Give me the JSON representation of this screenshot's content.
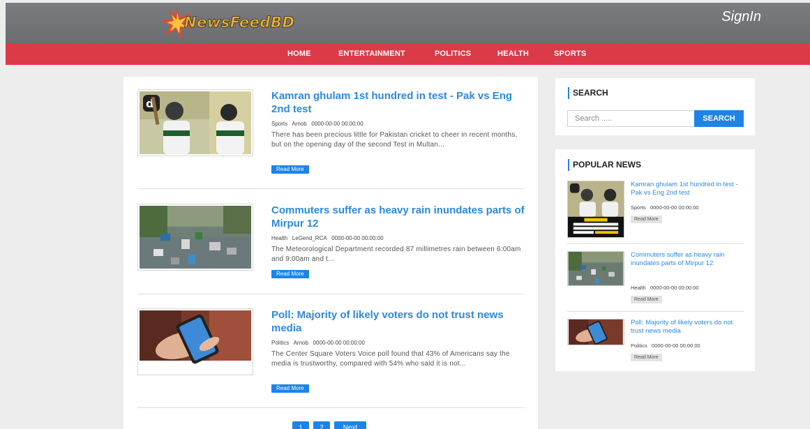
{
  "header": {
    "logo_text": "NewsFeedBD",
    "signin_label": "SignIn"
  },
  "nav": {
    "items": [
      "HOME",
      "ENTERTAINMENT",
      "POLITICS",
      "HEALTH",
      "SPORTS"
    ]
  },
  "articles": [
    {
      "title": "Kamran ghulam 1st hundred in test - Pak vs Eng 2nd test",
      "category": "Sports",
      "author": "Arnob",
      "date": "0000-00-00 00:00:00",
      "excerpt": "There has been precious little for Pakistan cricket to cheer in recent months, but on the opening day of the second Test in Multan...",
      "read_more": "Read More",
      "thumb_icon": "cricket-players-image"
    },
    {
      "title": "Commuters suffer as heavy rain inundates parts of Mirpur 12",
      "category": "Health",
      "author": "LeGend_RCA",
      "date": "0000-00-00 00:00:00",
      "excerpt": "The Meteorological Department recorded 87 millimetres rain between 6:00am and 9:00am and t...",
      "read_more": "Read More",
      "thumb_icon": "flooded-street-image"
    },
    {
      "title": "Poll: Majority of likely voters do not trust news media",
      "category": "Politics",
      "author": "Arnob",
      "date": "0000-00-00 00:00:00",
      "excerpt": "The Center Square Voters Voice poll found that 43% of Americans say the media is trustworthy, compared with 54% who said it is not...",
      "read_more": "Read More",
      "thumb_icon": "smartphone-hand-image"
    }
  ],
  "pagination": {
    "pages": [
      "1",
      "2"
    ],
    "next_label": "Next"
  },
  "search": {
    "heading": "SEARCH",
    "placeholder": "Search .....",
    "button_label": "SEARCH"
  },
  "popular": {
    "heading": "POPULAR NEWS",
    "items": [
      {
        "title": "Kamran ghulam 1st hundred in test - Pak vs Eng 2nd test",
        "category": "Sports",
        "date": "0000-00-00 00:00:00",
        "read_more": "Read More",
        "thumb_caption": "Replacement Kamran Ghulam Scores Brilliant Century Against England"
      },
      {
        "title": "Commuters suffer as heavy rain inundates parts of Mirpur 12",
        "category": "Health",
        "date": "0000-00-00 00:00:00",
        "read_more": "Read More"
      },
      {
        "title": "Poll: Majority of likely voters do not trust news media",
        "category": "Politics",
        "date": "0000-00-00 00:00:00",
        "read_more": "Read More"
      }
    ]
  },
  "colors": {
    "header_bg": "#6f7175",
    "nav_bg": "#db3a48",
    "link_blue": "#2b89e0",
    "button_blue": "#1d84e6",
    "page_bg": "#ededed"
  }
}
